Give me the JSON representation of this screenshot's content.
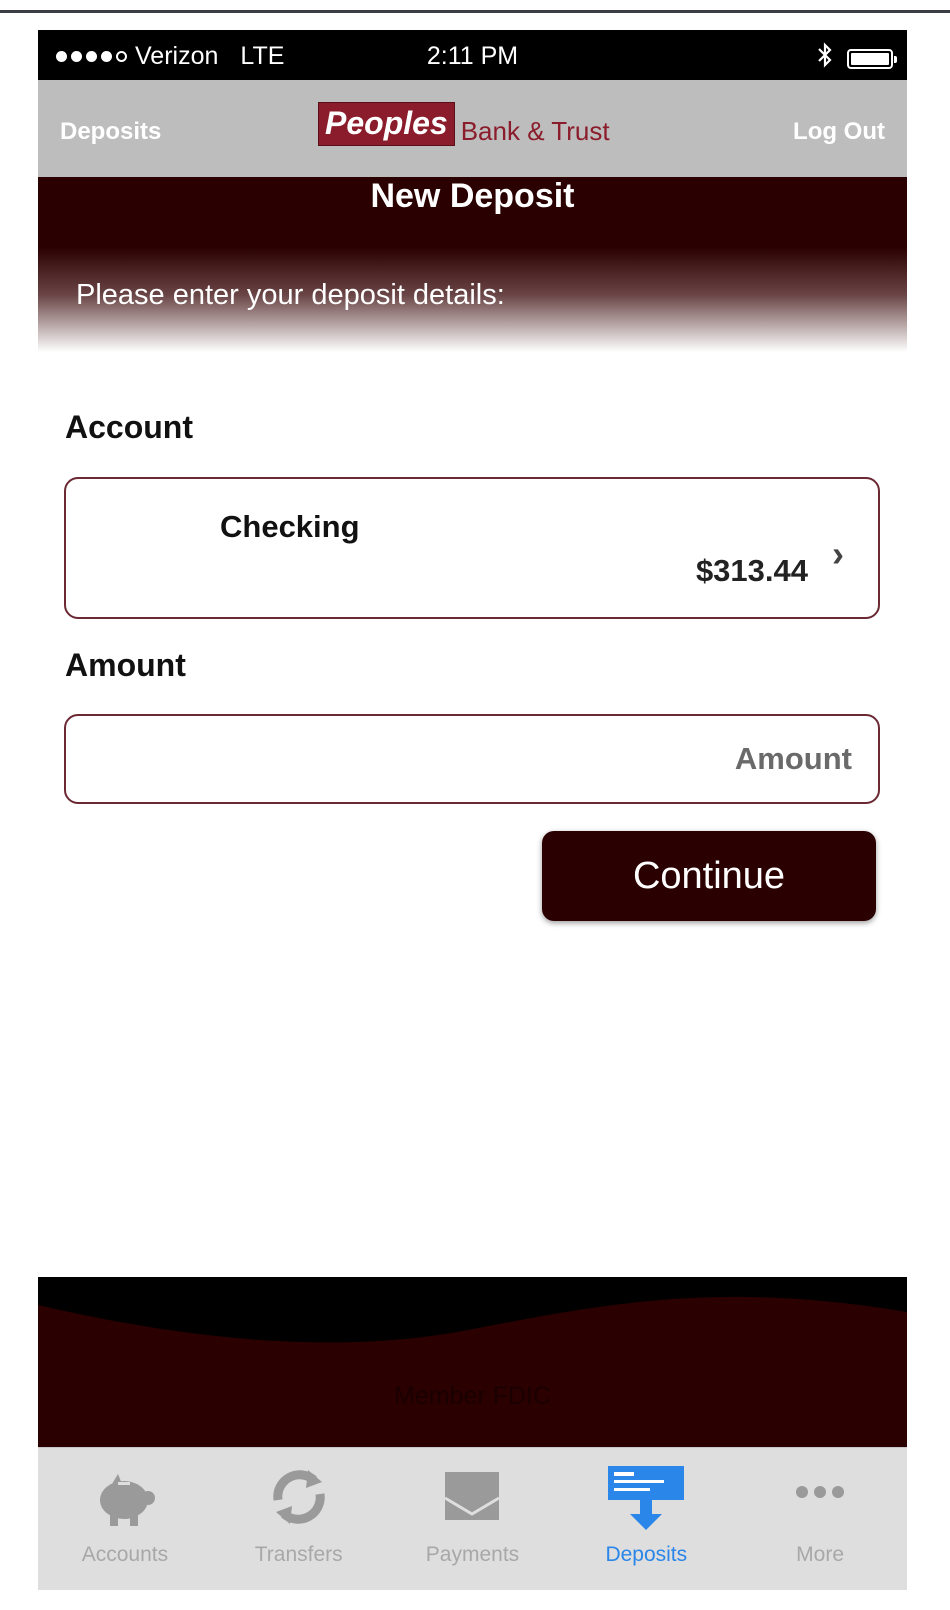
{
  "status_bar": {
    "carrier": "Verizon",
    "network": "LTE",
    "time": "2:11 PM"
  },
  "nav": {
    "left_label": "Deposits",
    "logo_main": "Peoples",
    "logo_sub": "Bank & Trust",
    "right_label": "Log Out"
  },
  "header": {
    "title": "New Deposit",
    "subtitle": "Please enter your deposit details:"
  },
  "form": {
    "account_label": "Account",
    "account": {
      "name": "Checking",
      "balance": "$313.44"
    },
    "amount_label": "Amount",
    "amount_placeholder": "Amount",
    "amount_value": "",
    "continue_label": "Continue"
  },
  "footer": {
    "member_text": "Member FDIC"
  },
  "tabs": [
    {
      "label": "Accounts",
      "icon": "piggy-bank-icon",
      "active": false
    },
    {
      "label": "Transfers",
      "icon": "transfer-arrows-icon",
      "active": false
    },
    {
      "label": "Payments",
      "icon": "envelope-icon",
      "active": false
    },
    {
      "label": "Deposits",
      "icon": "check-deposit-icon",
      "active": true
    },
    {
      "label": "More",
      "icon": "more-dots-icon",
      "active": false
    }
  ],
  "colors": {
    "brand_dark": "#2a0000",
    "brand_red": "#8b1c2b",
    "active_tab": "#2a86e8",
    "inactive_tab": "#a8a8a8"
  }
}
